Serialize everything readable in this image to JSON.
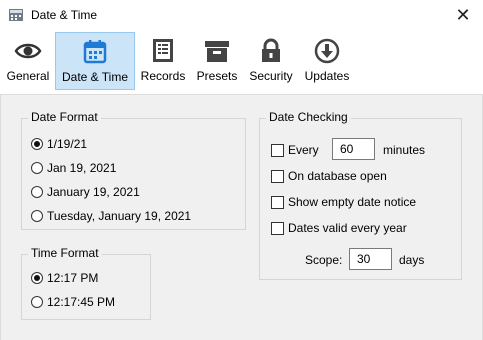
{
  "window": {
    "title": "Date & Time",
    "close_glyph": "✕"
  },
  "toolbar": {
    "items": [
      {
        "label": "General",
        "icon": "eye-icon"
      },
      {
        "label": "Date & Time",
        "icon": "calendar-icon",
        "selected": true
      },
      {
        "label": "Records",
        "icon": "records-icon"
      },
      {
        "label": "Presets",
        "icon": "presets-icon"
      },
      {
        "label": "Security",
        "icon": "lock-icon"
      },
      {
        "label": "Updates",
        "icon": "download-icon"
      }
    ]
  },
  "date_format": {
    "title": "Date Format",
    "options": [
      "1/19/21",
      "Jan 19, 2021",
      "January 19, 2021",
      "Tuesday, January 19, 2021"
    ],
    "selected_index": 0
  },
  "time_format": {
    "title": "Time Format",
    "options": [
      "12:17 PM",
      "12:17:45 PM"
    ],
    "selected_index": 0
  },
  "date_checking": {
    "title": "Date Checking",
    "every_label": "Every",
    "every_value": "60",
    "every_unit": "minutes",
    "on_open_label": "On database open",
    "empty_notice_label": "Show empty date notice",
    "valid_year_label": "Dates valid every year",
    "scope_label": "Scope:",
    "scope_value": "30",
    "scope_unit": "days",
    "checks": {
      "every": false,
      "on_open": false,
      "empty_notice": false,
      "valid_year": false
    }
  },
  "colors": {
    "selected_tab_bg": "#cce4f7",
    "selected_tab_border": "#99c9ef",
    "calendar_blue": "#1e7ad6"
  }
}
